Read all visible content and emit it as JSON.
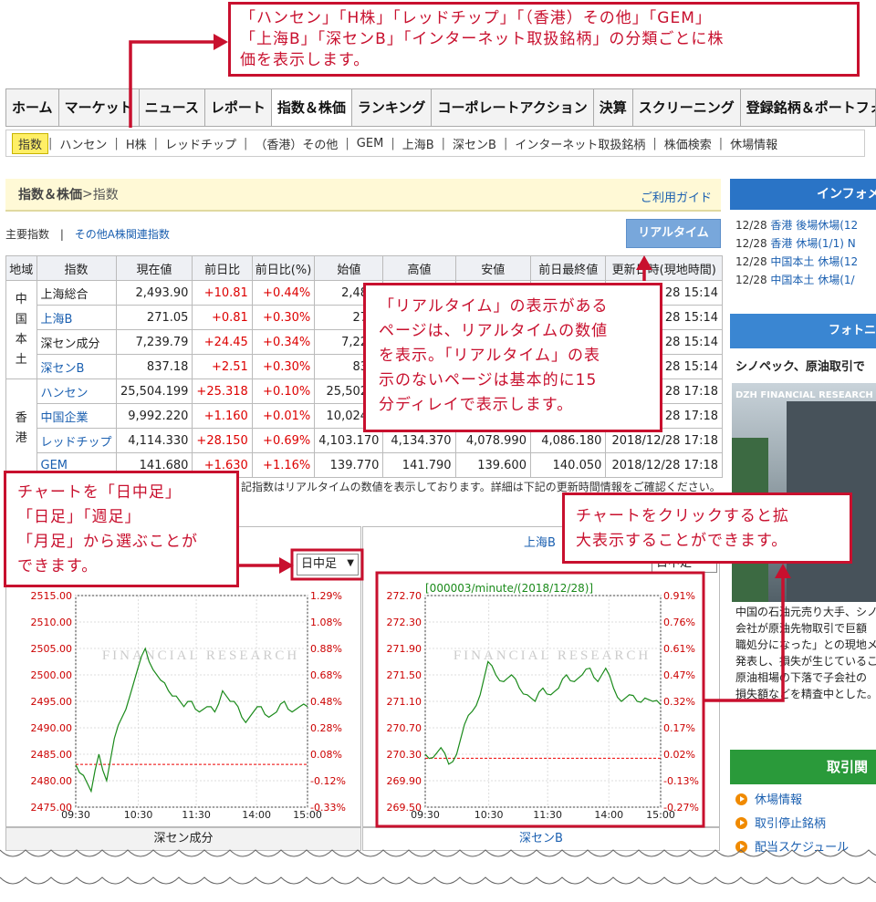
{
  "callouts": {
    "top": [
      "「ハンセン」「H株」「レッドチップ」「（香港）その他」「GEM」",
      "「上海B」「深センB」「インターネット取扱銘柄」の分類ごとに株",
      "価を表示します。"
    ],
    "realtime": [
      "「リアルタイム」の表示がある",
      "ページは、リアルタイムの数値",
      "を表示。「リアルタイム」の表",
      "示のないページは基本的に15",
      "分ディレイで表示します。"
    ],
    "chart_period": [
      "チャートを「日中足」",
      "「日足」「週足」",
      "「月足」から選ぶことが",
      "できます。"
    ],
    "chart_click": [
      "チャートをクリックすると拡",
      "大表示することができます。"
    ]
  },
  "main_nav": [
    "ホーム",
    "マーケット",
    "ニュース",
    "レポート",
    "指数＆株価",
    "ランキング",
    "コーポレートアクション",
    "決算",
    "スクリーニング",
    "登録銘柄＆ポートフォ"
  ],
  "sub_nav": [
    "指数",
    "ハンセン",
    "H株",
    "レッドチップ",
    "（香港）その他",
    "GEM",
    "上海B",
    "深センB",
    "インターネット取扱銘柄",
    "株価検索",
    "休場情報"
  ],
  "breadcrumb": {
    "parent": "指数＆株価",
    "sep": " > ",
    "current": "指数",
    "guide": "ご利用ガイド"
  },
  "links": {
    "main": "主要指数",
    "sep": "|",
    "other": "その他A株関連指数"
  },
  "realtime_button": "リアルタイム",
  "table": {
    "headers": [
      "地域",
      "指数",
      "現在値",
      "前日比",
      "前日比(%)",
      "始値",
      "高値",
      "安値",
      "前日最終値",
      "更新日時(現地時間)"
    ],
    "regions": {
      "china": "中国\n本土",
      "hk": "香港"
    },
    "rows": [
      {
        "name": "上海総合",
        "link": false,
        "price": "2,493.90",
        "chg": "+10.81",
        "pct": "+0.44%",
        "open": "2,483.",
        "high": "",
        "low": "",
        "prev": "",
        "time": "28 15:14"
      },
      {
        "name": "上海B",
        "link": true,
        "price": "271.05",
        "chg": "+0.81",
        "pct": "+0.30%",
        "open": "270.",
        "high": "",
        "low": "",
        "prev": "",
        "time": "28 15:14"
      },
      {
        "name": "深セン成分",
        "link": false,
        "price": "7,239.79",
        "chg": "+24.45",
        "pct": "+0.34%",
        "open": "7,229.",
        "high": "",
        "low": "",
        "prev": "",
        "time": "28 15:14"
      },
      {
        "name": "深センB",
        "link": true,
        "price": "837.18",
        "chg": "+2.51",
        "pct": "+0.30%",
        "open": "832.",
        "high": "",
        "low": "",
        "prev": "",
        "time": "28 15:14"
      },
      {
        "name": "ハンセン",
        "link": true,
        "price": "25,504.199",
        "chg": "+25.318",
        "pct": "+0.10%",
        "open": "25,502.3",
        "high": "",
        "low": "",
        "prev": "",
        "time": "28 17:18"
      },
      {
        "name": "中国企業",
        "link": true,
        "price": "9,992.220",
        "chg": "+1.160",
        "pct": "+0.01%",
        "open": "10,024.1",
        "high": "",
        "low": "",
        "prev": "",
        "time": "28 17:18"
      },
      {
        "name": "レッドチップ",
        "link": true,
        "price": "4,114.330",
        "chg": "+28.150",
        "pct": "+0.69%",
        "open": "4,103.170",
        "high": "4,134.370",
        "low": "4,078.990",
        "prev": "4,086.180",
        "time": "2018/12/28 17:18"
      },
      {
        "name": "GEM",
        "link": true,
        "price": "141.680",
        "chg": "+1.630",
        "pct": "+1.16%",
        "open": "139.770",
        "high": "141.790",
        "low": "139.600",
        "prev": "140.050",
        "time": "2018/12/28 17:18"
      }
    ]
  },
  "table_note": "記指数はリアルタイムの数値を表示しております。詳細は下記の更新時間情報をご確認ください。",
  "charts": {
    "left": {
      "period_select": "日中足",
      "bottom_tab": "深セン成分",
      "watermark": "FINANCIAL RESEARCH"
    },
    "right": {
      "heading": "上海B",
      "period_select": "日中足",
      "title": "[000003/minute/(2018/12/28)]",
      "bottom_tab": "深センB",
      "watermark": "FINANCIAL RESEARCH"
    }
  },
  "chart_data": [
    {
      "type": "line",
      "title": "",
      "x_ticks": [
        "09:30",
        "10:30",
        "11:30",
        "14:00",
        "15:00"
      ],
      "y_left_ticks": [
        "2515.00",
        "2510.00",
        "2505.00",
        "2500.00",
        "2495.00",
        "2490.00",
        "2485.00",
        "2480.00",
        "2475.00"
      ],
      "y_right_ticks": [
        "1.29%",
        "1.08%",
        "0.88%",
        "0.68%",
        "0.48%",
        "0.28%",
        "0.08%",
        "-0.12%",
        "-0.33%"
      ],
      "ylim": [
        2475,
        2515
      ],
      "prev_close": 2483.09,
      "series": [
        {
          "values": [
            2483,
            2481,
            2478,
            2485,
            2480,
            2488,
            2492,
            2496,
            2501,
            2505,
            2501,
            2499,
            2497,
            2496,
            2494,
            2495,
            2493,
            2494,
            2493,
            2497,
            2495,
            2494,
            2491,
            2493,
            2494,
            2492,
            2493,
            2495,
            2493,
            2494,
            2494
          ]
        }
      ]
    },
    {
      "type": "line",
      "title": "[000003/minute/(2018/12/28)]",
      "x_ticks": [
        "09:30",
        "10:30",
        "11:30",
        "14:00",
        "15:00"
      ],
      "y_left_ticks": [
        "272.70",
        "272.30",
        "271.90",
        "271.50",
        "271.10",
        "270.70",
        "270.30",
        "269.90",
        "269.50"
      ],
      "y_right_ticks": [
        "0.91%",
        "0.76%",
        "0.61%",
        "0.47%",
        "0.32%",
        "0.17%",
        "0.02%",
        "-0.13%",
        "-0.27%"
      ],
      "ylim": [
        269.5,
        272.7
      ],
      "prev_close": 270.24,
      "series": [
        {
          "values": [
            270.3,
            270.25,
            270.4,
            270.15,
            270.3,
            270.75,
            270.95,
            271.2,
            271.7,
            271.5,
            271.4,
            271.5,
            271.3,
            271.2,
            271.1,
            271.3,
            271.2,
            271.3,
            271.5,
            271.4,
            271.5,
            271.6,
            271.4,
            271.6,
            271.3,
            271.1,
            271.2,
            271.1,
            271.15,
            271.1,
            271.05
          ]
        }
      ]
    }
  ],
  "right_col": {
    "info_title": "インフォメ",
    "news": [
      {
        "date": "12/28",
        "text": "香港 後場休場(12"
      },
      {
        "date": "12/28",
        "text": "香港 休場(1/1) N"
      },
      {
        "date": "12/28",
        "text": "中国本土 休場(12"
      },
      {
        "date": "12/28",
        "text": "中国本土 休場(1/"
      }
    ],
    "photo_title": "フォトニ",
    "photo_headline": "シノペック、原油取引で",
    "photo_caption": "DZH FINANCIAL RESEARCH",
    "photo_text": [
      "中国の石油元売り大手、シノ",
      "会社が原油先物取引で巨額",
      "職処分になった」との現地メ",
      "発表し、損失が生じているこ",
      "原油相場の下落で子会社の",
      "損失額などを精査中とした。"
    ],
    "torihiki_title": "取引関",
    "links": [
      "休場情報",
      "取引停止銘柄",
      "配当スケジュール"
    ]
  }
}
